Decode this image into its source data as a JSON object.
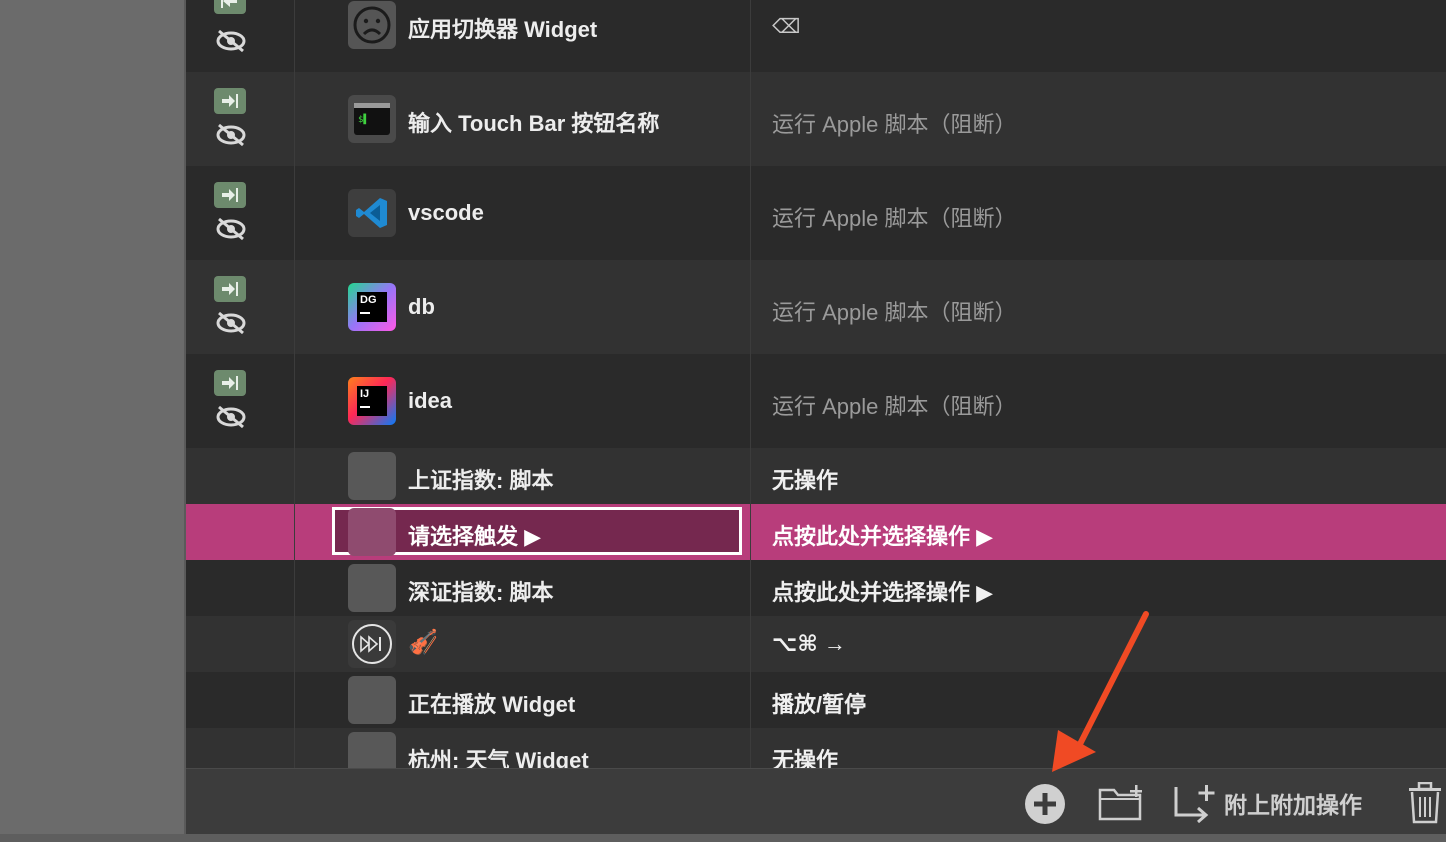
{
  "table": {
    "rows": [
      {
        "trigger": "应用切换器 Widget",
        "action": "⌫",
        "icon": "sad-face-icon",
        "status": true
      },
      {
        "trigger": "输入 Touch Bar 按钮名称",
        "action": "运行 Apple 脚本（阻断）",
        "icon": "terminal-icon",
        "status": true
      },
      {
        "trigger": "vscode",
        "action": "运行 Apple 脚本（阻断）",
        "icon": "vscode-icon",
        "status": true
      },
      {
        "trigger": "db",
        "action": "运行 Apple 脚本（阻断）",
        "icon": "datagrip-icon",
        "icon_text": "DG",
        "status": true
      },
      {
        "trigger": "idea",
        "action": "运行 Apple 脚本（阻断）",
        "icon": "intellij-icon",
        "icon_text": "IJ",
        "status": true
      },
      {
        "trigger": "上证指数: 脚本",
        "action": "无操作",
        "icon": "blank-icon",
        "status": false
      },
      {
        "trigger": "请选择触发 ▶",
        "action": "点按此处并选择操作 ▶",
        "icon": "blank-icon",
        "status": false,
        "selected": true
      },
      {
        "trigger": "深证指数: 脚本",
        "action": "点按此处并选择操作 ▶",
        "icon": "blank-icon",
        "status": false
      },
      {
        "trigger": "🎻",
        "action": "⌥⌘ →",
        "icon": "fast-forward-icon",
        "status": false
      },
      {
        "trigger": "正在播放 Widget",
        "action": "播放/暂停",
        "icon": "blank-icon",
        "status": false
      },
      {
        "trigger": "杭州: 天气 Widget",
        "action": "无操作",
        "icon": "blank-icon",
        "status": false
      }
    ]
  },
  "toolbar": {
    "add_icon": "plus-circle-icon",
    "folder_icon": "new-folder-icon",
    "attach_icon": "attach-action-icon",
    "attach_label": "附上附加操作",
    "trash_icon": "trash-icon"
  },
  "colors": {
    "selection": "#b83d7b",
    "annotation_arrow": "#f04a24"
  }
}
